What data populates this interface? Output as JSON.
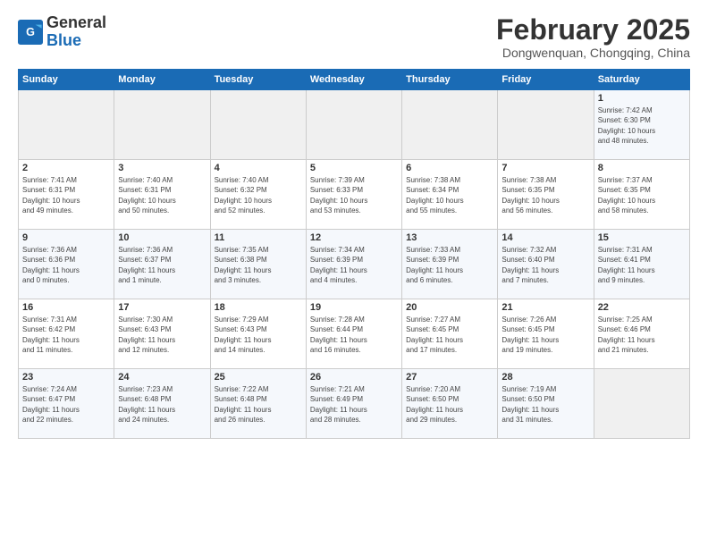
{
  "header": {
    "logo_line1": "General",
    "logo_line2": "Blue",
    "title": "February 2025",
    "subtitle": "Dongwenquan, Chongqing, China"
  },
  "weekdays": [
    "Sunday",
    "Monday",
    "Tuesday",
    "Wednesday",
    "Thursday",
    "Friday",
    "Saturday"
  ],
  "weeks": [
    [
      {
        "day": "",
        "info": ""
      },
      {
        "day": "",
        "info": ""
      },
      {
        "day": "",
        "info": ""
      },
      {
        "day": "",
        "info": ""
      },
      {
        "day": "",
        "info": ""
      },
      {
        "day": "",
        "info": ""
      },
      {
        "day": "1",
        "info": "Sunrise: 7:42 AM\nSunset: 6:30 PM\nDaylight: 10 hours\nand 48 minutes."
      }
    ],
    [
      {
        "day": "2",
        "info": "Sunrise: 7:41 AM\nSunset: 6:31 PM\nDaylight: 10 hours\nand 49 minutes."
      },
      {
        "day": "3",
        "info": "Sunrise: 7:40 AM\nSunset: 6:31 PM\nDaylight: 10 hours\nand 50 minutes."
      },
      {
        "day": "4",
        "info": "Sunrise: 7:40 AM\nSunset: 6:32 PM\nDaylight: 10 hours\nand 52 minutes."
      },
      {
        "day": "5",
        "info": "Sunrise: 7:39 AM\nSunset: 6:33 PM\nDaylight: 10 hours\nand 53 minutes."
      },
      {
        "day": "6",
        "info": "Sunrise: 7:38 AM\nSunset: 6:34 PM\nDaylight: 10 hours\nand 55 minutes."
      },
      {
        "day": "7",
        "info": "Sunrise: 7:38 AM\nSunset: 6:35 PM\nDaylight: 10 hours\nand 56 minutes."
      },
      {
        "day": "8",
        "info": "Sunrise: 7:37 AM\nSunset: 6:35 PM\nDaylight: 10 hours\nand 58 minutes."
      }
    ],
    [
      {
        "day": "9",
        "info": "Sunrise: 7:36 AM\nSunset: 6:36 PM\nDaylight: 11 hours\nand 0 minutes."
      },
      {
        "day": "10",
        "info": "Sunrise: 7:36 AM\nSunset: 6:37 PM\nDaylight: 11 hours\nand 1 minute."
      },
      {
        "day": "11",
        "info": "Sunrise: 7:35 AM\nSunset: 6:38 PM\nDaylight: 11 hours\nand 3 minutes."
      },
      {
        "day": "12",
        "info": "Sunrise: 7:34 AM\nSunset: 6:39 PM\nDaylight: 11 hours\nand 4 minutes."
      },
      {
        "day": "13",
        "info": "Sunrise: 7:33 AM\nSunset: 6:39 PM\nDaylight: 11 hours\nand 6 minutes."
      },
      {
        "day": "14",
        "info": "Sunrise: 7:32 AM\nSunset: 6:40 PM\nDaylight: 11 hours\nand 7 minutes."
      },
      {
        "day": "15",
        "info": "Sunrise: 7:31 AM\nSunset: 6:41 PM\nDaylight: 11 hours\nand 9 minutes."
      }
    ],
    [
      {
        "day": "16",
        "info": "Sunrise: 7:31 AM\nSunset: 6:42 PM\nDaylight: 11 hours\nand 11 minutes."
      },
      {
        "day": "17",
        "info": "Sunrise: 7:30 AM\nSunset: 6:43 PM\nDaylight: 11 hours\nand 12 minutes."
      },
      {
        "day": "18",
        "info": "Sunrise: 7:29 AM\nSunset: 6:43 PM\nDaylight: 11 hours\nand 14 minutes."
      },
      {
        "day": "19",
        "info": "Sunrise: 7:28 AM\nSunset: 6:44 PM\nDaylight: 11 hours\nand 16 minutes."
      },
      {
        "day": "20",
        "info": "Sunrise: 7:27 AM\nSunset: 6:45 PM\nDaylight: 11 hours\nand 17 minutes."
      },
      {
        "day": "21",
        "info": "Sunrise: 7:26 AM\nSunset: 6:45 PM\nDaylight: 11 hours\nand 19 minutes."
      },
      {
        "day": "22",
        "info": "Sunrise: 7:25 AM\nSunset: 6:46 PM\nDaylight: 11 hours\nand 21 minutes."
      }
    ],
    [
      {
        "day": "23",
        "info": "Sunrise: 7:24 AM\nSunset: 6:47 PM\nDaylight: 11 hours\nand 22 minutes."
      },
      {
        "day": "24",
        "info": "Sunrise: 7:23 AM\nSunset: 6:48 PM\nDaylight: 11 hours\nand 24 minutes."
      },
      {
        "day": "25",
        "info": "Sunrise: 7:22 AM\nSunset: 6:48 PM\nDaylight: 11 hours\nand 26 minutes."
      },
      {
        "day": "26",
        "info": "Sunrise: 7:21 AM\nSunset: 6:49 PM\nDaylight: 11 hours\nand 28 minutes."
      },
      {
        "day": "27",
        "info": "Sunrise: 7:20 AM\nSunset: 6:50 PM\nDaylight: 11 hours\nand 29 minutes."
      },
      {
        "day": "28",
        "info": "Sunrise: 7:19 AM\nSunset: 6:50 PM\nDaylight: 11 hours\nand 31 minutes."
      },
      {
        "day": "",
        "info": ""
      }
    ]
  ]
}
